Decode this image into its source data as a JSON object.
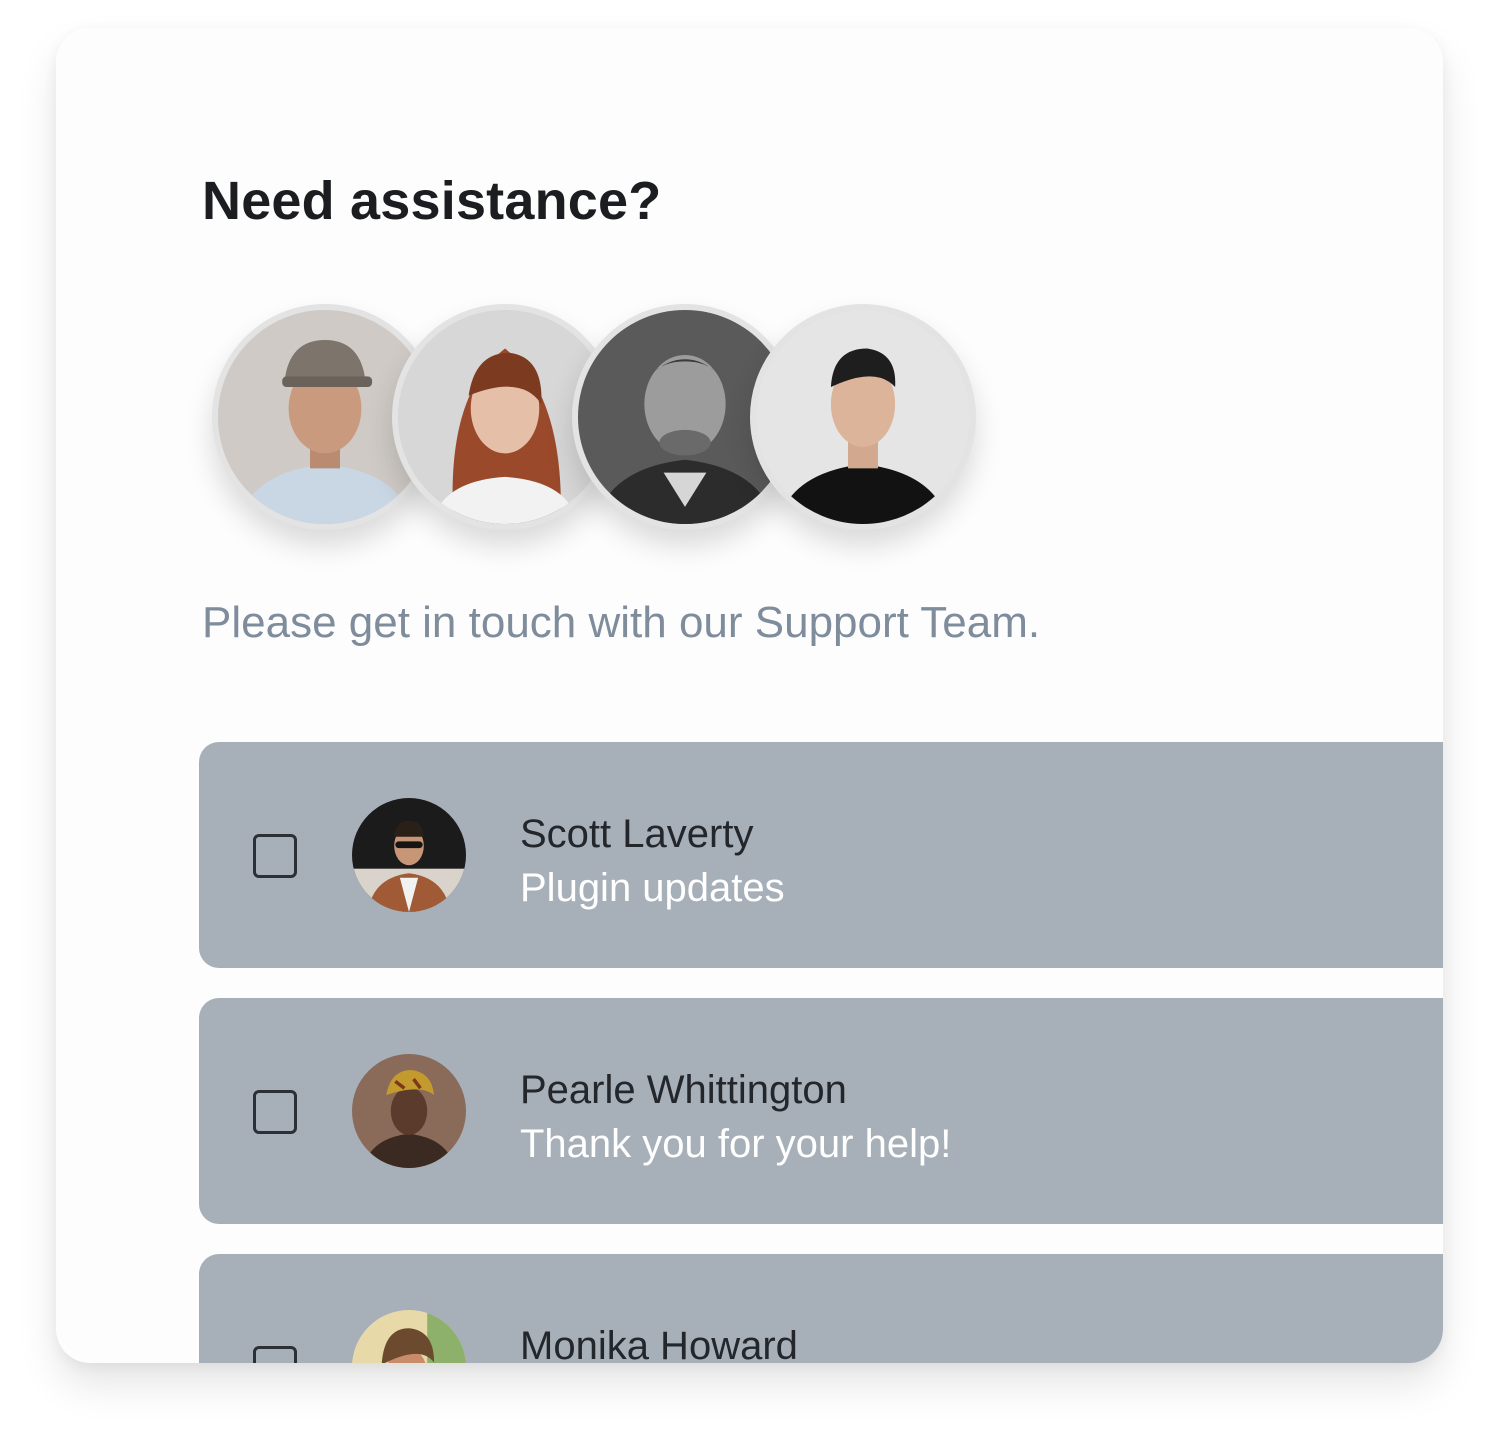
{
  "header": {
    "title": "Need assistance?",
    "subtitle": "Please get in touch with our Support Team."
  },
  "team_avatars": [
    {
      "icon": "team-member-photo"
    },
    {
      "icon": "team-member-photo"
    },
    {
      "icon": "team-member-photo"
    },
    {
      "icon": "team-member-photo"
    }
  ],
  "messages": [
    {
      "name": "Scott Laverty",
      "text": "Plugin updates",
      "checked": false
    },
    {
      "name": "Pearle Whittington",
      "text": "Thank you for your help!",
      "checked": false
    },
    {
      "name": "Monika Howard",
      "text": "",
      "checked": false
    }
  ],
  "colors": {
    "card_background": "#fdfdfd",
    "message_background": "#a7b0b9",
    "title": "#1c1d20",
    "subtitle": "#7e8c9c",
    "message_text": "#ffffff"
  }
}
